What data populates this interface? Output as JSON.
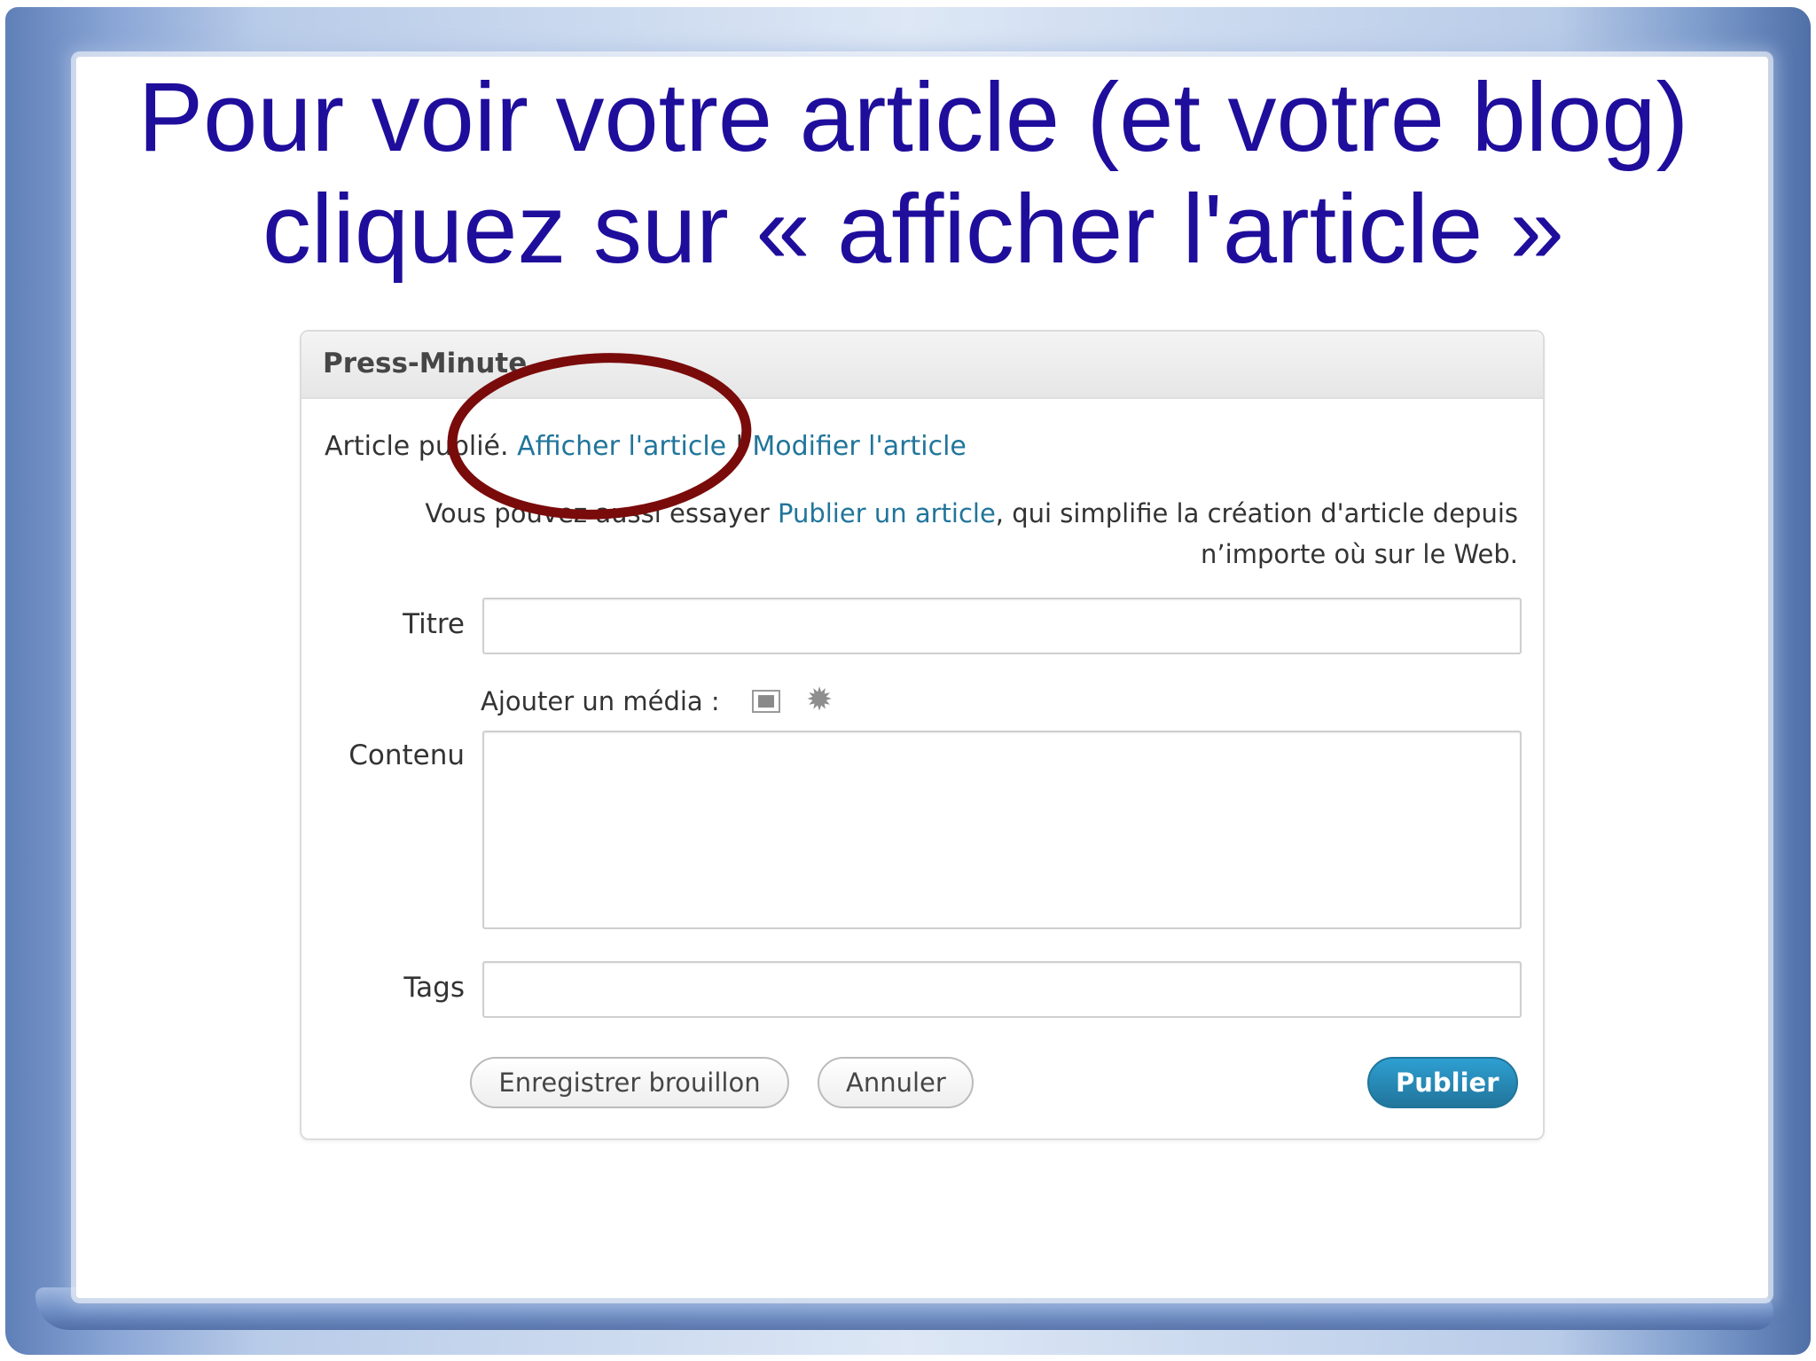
{
  "slide": {
    "title_line1": "Pour voir votre article (et votre blog)",
    "title_line2": "cliquez sur « afficher l'article »"
  },
  "panel": {
    "title": "Press-Minute",
    "notice": {
      "status": "Article publié.",
      "view_link": "Afficher l'article",
      "separator": "|",
      "edit_link": "Modifier l'article"
    },
    "hint": {
      "before": "Vous pouvez aussi essayer ",
      "link": "Publier un article",
      "after": ", qui simplifie la création d'article depuis n’importe où sur le Web."
    },
    "fields": {
      "title_label": "Titre",
      "title_value": "",
      "media_label": "Ajouter un média :",
      "content_label": "Contenu",
      "content_value": "",
      "tags_label": "Tags",
      "tags_value": ""
    },
    "buttons": {
      "draft": "Enregistrer brouillon",
      "cancel": "Annuler",
      "publish": "Publier"
    },
    "icons": {
      "media_image": "image-icon",
      "media_gear": "gear-icon"
    }
  },
  "colors": {
    "title_text": "#1f0e9c",
    "link": "#21759b",
    "publish_button": "#21759b",
    "highlight_ellipse": "#7a0b0b",
    "frame": "#6f8fc6"
  }
}
